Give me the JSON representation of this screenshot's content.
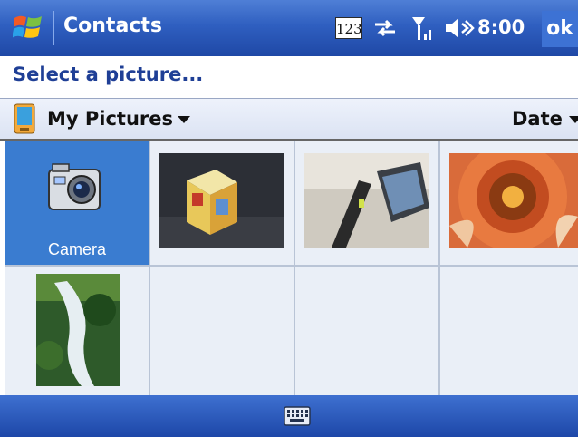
{
  "titlebar": {
    "app_title": "Contacts",
    "input_mode": "123",
    "time": "8:00",
    "ok_label": "ok"
  },
  "instruction": "Select a picture...",
  "folderbar": {
    "folder_label": "My Pictures",
    "sort_label": "Date"
  },
  "grid": {
    "camera_label": "Camera",
    "thumbnails": [
      {
        "subject": "boxed-product"
      },
      {
        "subject": "pda-device"
      },
      {
        "subject": "flower-closeup"
      },
      {
        "subject": "waterfall"
      }
    ]
  },
  "colors": {
    "title_blue": "#2f5fc0",
    "selection_blue": "#3a7cd0",
    "instruction_blue": "#1f3f96",
    "cell_bg": "#eaeff7"
  },
  "icons": [
    "windows-logo-icon",
    "input-mode-icon",
    "sync-icon",
    "signal-icon",
    "volume-icon",
    "folder-device-icon",
    "camera-icon",
    "keyboard-icon"
  ]
}
